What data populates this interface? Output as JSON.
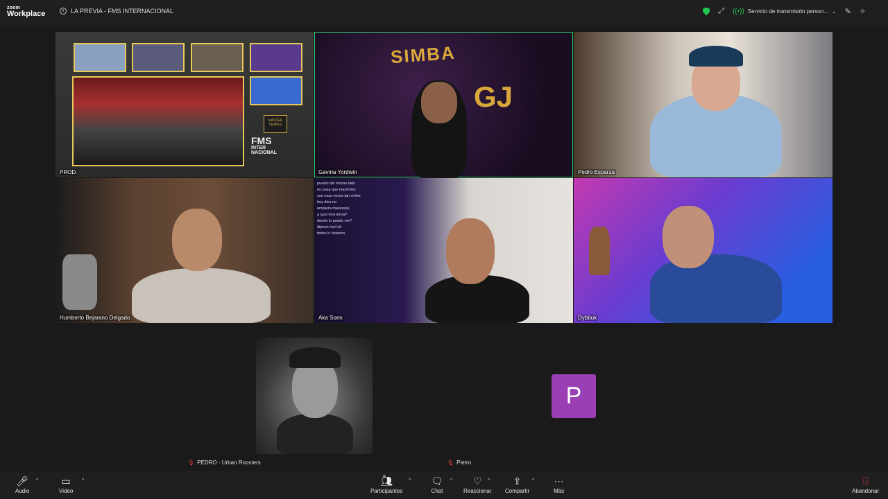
{
  "app": {
    "brand_top": "zoom",
    "brand_bottom": "Workplace"
  },
  "meeting": {
    "title": "LA PREVIA - FMS INTERNACIONAL"
  },
  "top_right": {
    "stream_label": "Servicio de transmisión person..."
  },
  "tiles": [
    {
      "name": "PROD."
    },
    {
      "name": "Gaviria Yordwin"
    },
    {
      "name": "Pedro Esparza"
    },
    {
      "name": "Humberto Bejarano Delgado"
    },
    {
      "name": "Aka Soen"
    },
    {
      "name": "Dybbuk"
    }
  ],
  "composite": {
    "fms_line1": "FMS",
    "fms_line2": "INTER",
    "fms_line3": "NACIONAL",
    "master_text": "MASTER SERIES"
  },
  "graffiti": {
    "word1": "SIMBA",
    "word2": "GJ"
  },
  "non_video": [
    {
      "name": "PEDRO - Urban Roosters"
    },
    {
      "name": "Pietro",
      "initial": "P"
    }
  ],
  "chat_overlay": [
    "puesto del mismo lado",
    "no pasa que machotes",
    "con esas voces tan viriles",
    "hoy dios no",
    "empieza massssss",
    "a que hora inicia?",
    "donde lo puedo ver?",
    "dijeron facil ok",
    "todos lo hicieron"
  ],
  "toolbar": {
    "audio": "Audio",
    "video": "Video",
    "participants": "Participantes",
    "participants_count": "8",
    "chat": "Chat",
    "react": "Reaccionar",
    "share": "Compartir",
    "more": "Más",
    "leave": "Abandonar"
  },
  "colors": {
    "speaking_border": "#2ecc71",
    "avatar_bg": "#9b3fb5",
    "leave_red": "#e03a3a",
    "secure_green": "#23c552"
  }
}
